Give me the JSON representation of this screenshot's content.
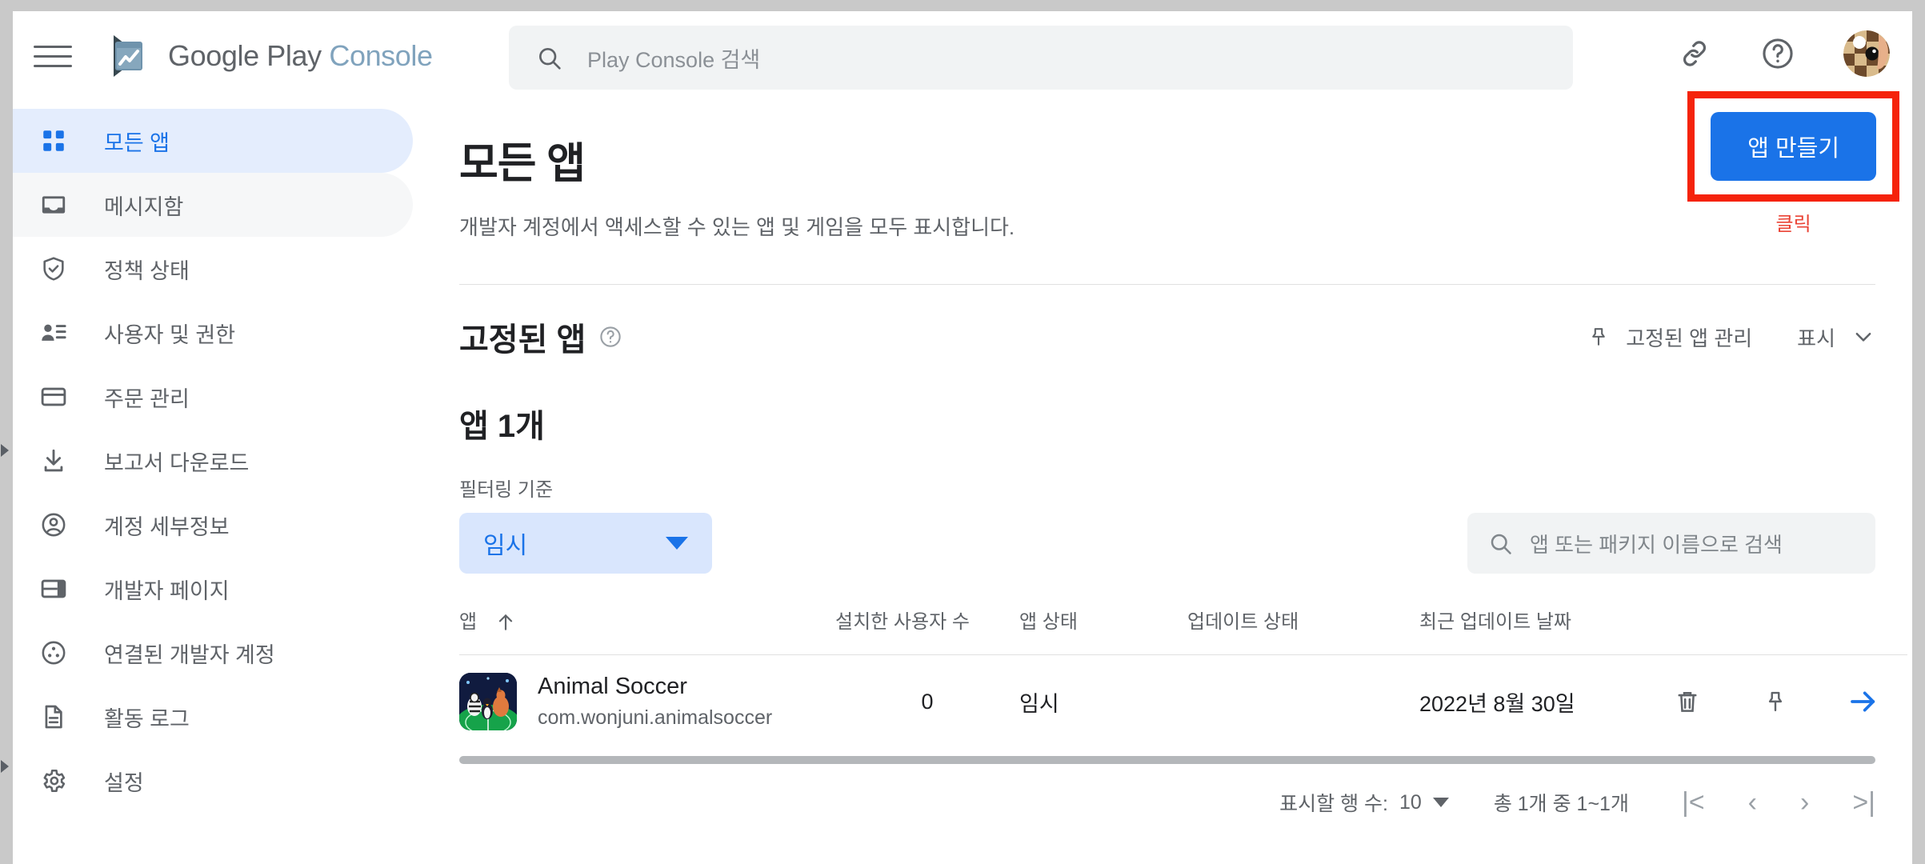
{
  "brand": {
    "name_primary": "Google Play",
    "name_secondary": "Console",
    "logo_icon": "play-console-logo-icon",
    "menu_icon": "hamburger-menu-icon"
  },
  "search": {
    "placeholder": "Play Console 검색",
    "icon": "search-icon"
  },
  "header_actions": {
    "link_icon": "link-icon",
    "help_icon": "help-circle-icon",
    "avatar_icon": "user-avatar"
  },
  "sidebar": {
    "items": [
      {
        "label": "모든 앱",
        "icon": "grid-apps-icon",
        "state": "active"
      },
      {
        "label": "메시지함",
        "icon": "inbox-icon",
        "state": "hover"
      },
      {
        "label": "정책 상태",
        "icon": "shield-check-icon",
        "state": "normal"
      },
      {
        "label": "사용자 및 권한",
        "icon": "user-permissions-icon",
        "state": "normal"
      },
      {
        "label": "주문 관리",
        "icon": "credit-card-icon",
        "state": "normal"
      },
      {
        "label": "보고서 다운로드",
        "icon": "download-icon",
        "state": "normal"
      },
      {
        "label": "계정 세부정보",
        "icon": "account-circle-icon",
        "state": "normal"
      },
      {
        "label": "개발자 페이지",
        "icon": "developer-page-icon",
        "state": "normal"
      },
      {
        "label": "연결된 개발자 계정",
        "icon": "linked-accounts-icon",
        "state": "normal"
      },
      {
        "label": "활동 로그",
        "icon": "document-log-icon",
        "state": "normal"
      },
      {
        "label": "설정",
        "icon": "gear-icon",
        "state": "normal"
      }
    ]
  },
  "page": {
    "title": "모든 앱",
    "subtitle": "개발자 계정에서 액세스할 수 있는 앱 및 게임을 모두 표시합니다.",
    "create_button": "앱 만들기",
    "annotation_label": "클릭",
    "annotation_color": "#f5230b"
  },
  "pinned": {
    "title": "고정된 앱",
    "help_icon": "help-circle-icon",
    "manage_label": "고정된 앱 관리",
    "manage_icon": "pin-icon",
    "display_label": "표시",
    "display_icon": "chevron-down-icon"
  },
  "apps_section": {
    "count_title": "앱 1개",
    "filter_label": "필터링 기준",
    "filter_value": "임시",
    "filter_caret_icon": "caret-down-icon",
    "table_search_placeholder": "앱 또는 패키지 이름으로 검색",
    "table_search_icon": "search-icon"
  },
  "table": {
    "columns": [
      {
        "key": "app",
        "label": "앱",
        "sort_icon": "arrow-up-icon"
      },
      {
        "key": "installs",
        "label": "설치한 사용자 수"
      },
      {
        "key": "app_status",
        "label": "앱 상태"
      },
      {
        "key": "update_status",
        "label": "업데이트 상태"
      },
      {
        "key": "last_update",
        "label": "최근 업데이트 날짜"
      }
    ],
    "rows": [
      {
        "app_name": "Animal Soccer",
        "package": "com.wonjuni.animalsoccer",
        "app_icon": "animal-soccer-app-icon",
        "installs": "0",
        "app_status": "임시",
        "update_status": "",
        "last_update": "2022년 8월 30일",
        "delete_icon": "trash-icon",
        "pin_icon": "pin-icon",
        "open_icon": "arrow-right-icon"
      }
    ]
  },
  "pagination": {
    "rows_label": "표시할 행 수:",
    "rows_value": "10",
    "rows_caret_icon": "caret-down-icon",
    "range_label": "총 1개 중 1~1개",
    "first_icon": "|<",
    "prev_icon": "‹",
    "next_icon": "›",
    "last_icon": ">|"
  },
  "colors": {
    "accent_blue": "#1a73e8",
    "chip_bg": "#d9e6fd",
    "active_nav_bg": "#e4edfd",
    "annotation_red": "#f5230b"
  }
}
